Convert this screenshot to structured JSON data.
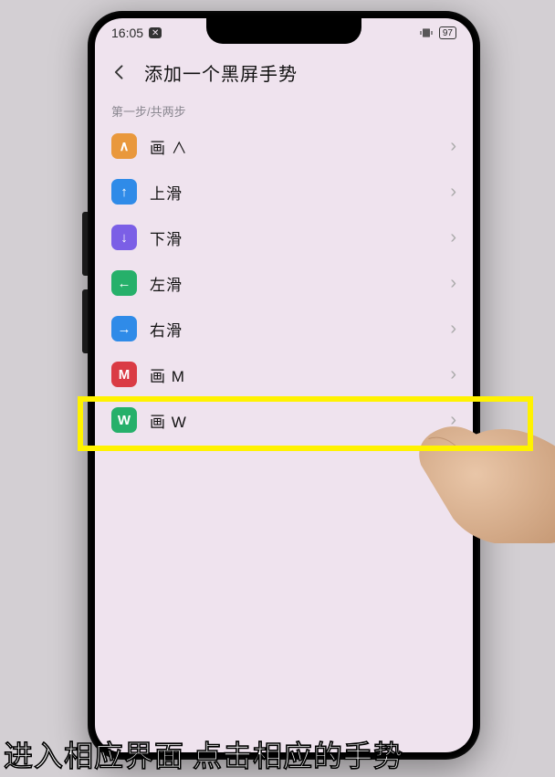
{
  "status": {
    "time": "16:05",
    "battery_text": "97"
  },
  "header": {
    "title": "添加一个黑屏手势"
  },
  "section": {
    "step_label": "第一步/共两步"
  },
  "gestures": [
    {
      "id": "draw-caret",
      "name": "画 ∧",
      "icon_text": "∧",
      "icon_color": "#e9983c",
      "icon_name": "caret-icon"
    },
    {
      "id": "swipe-up",
      "name": "上滑",
      "icon_text": "↑",
      "icon_color": "#2f8be8",
      "icon_name": "arrow-up-icon"
    },
    {
      "id": "swipe-down",
      "name": "下滑",
      "icon_text": "↓",
      "icon_color": "#7b5fe6",
      "icon_name": "arrow-down-icon"
    },
    {
      "id": "swipe-left",
      "name": "左滑",
      "icon_text": "←",
      "icon_color": "#26b06a",
      "icon_name": "arrow-left-icon"
    },
    {
      "id": "swipe-right",
      "name": "右滑",
      "icon_text": "→",
      "icon_color": "#2f8be8",
      "icon_name": "arrow-right-icon"
    },
    {
      "id": "draw-m",
      "name": "画 M",
      "icon_text": "M",
      "icon_color": "#da3b44",
      "icon_name": "letter-m-icon"
    },
    {
      "id": "draw-w",
      "name": "画 W",
      "icon_text": "W",
      "icon_color": "#26b06a",
      "icon_name": "letter-w-icon"
    }
  ],
  "caption": "进入相应界面 点击相应的手势",
  "highlighted_gesture_index": 6
}
